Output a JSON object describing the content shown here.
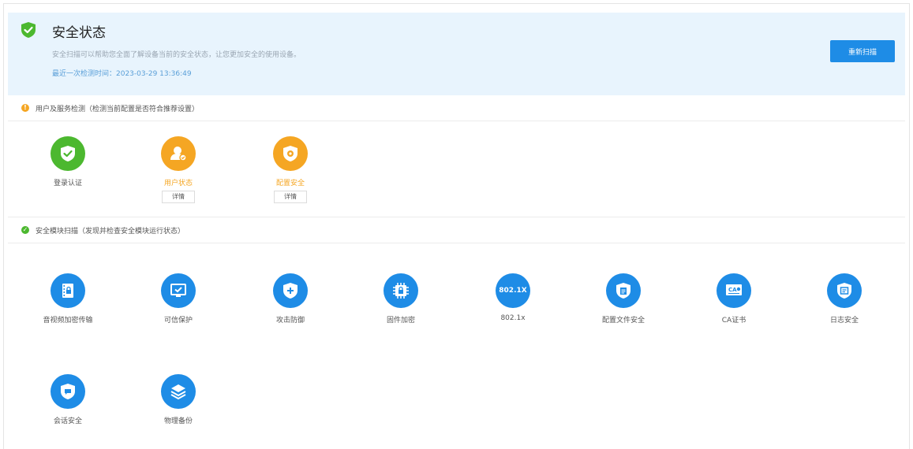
{
  "banner": {
    "title": "安全状态",
    "description": "安全扫描可以帮助您全面了解设备当前的安全状态，让您更加安全的使用设备。",
    "last_check": "最近一次检测时间：2023-03-29 13:36:49",
    "rescan_label": "重新扫描"
  },
  "section1": {
    "label": "用户及服务检测（检测当前配置是否符合推荐设置）",
    "items": [
      {
        "label": "登录认证",
        "icon": "shield-check-icon",
        "status": "ok"
      },
      {
        "label": "用户状态",
        "icon": "user-icon",
        "status": "warning",
        "detail": "详情"
      },
      {
        "label": "配置安全",
        "icon": "shield-gear-icon",
        "status": "warning",
        "detail": "详情"
      }
    ]
  },
  "section2": {
    "label": "安全模块扫描（发现并检查安全模块运行状态）",
    "items": [
      {
        "label": "音视频加密传输",
        "icon": "film-lock-icon"
      },
      {
        "label": "可信保护",
        "icon": "monitor-check-icon"
      },
      {
        "label": "攻击防御",
        "icon": "shield-plus-icon"
      },
      {
        "label": "固件加密",
        "icon": "chip-lock-icon"
      },
      {
        "label": "802.1x",
        "icon": "802-1x-icon",
        "icon_text": "802.1X"
      },
      {
        "label": "配置文件安全",
        "icon": "file-shield-icon"
      },
      {
        "label": "CA证书",
        "icon": "ca-certificate-icon",
        "icon_text": "CA"
      },
      {
        "label": "日志安全",
        "icon": "log-shield-icon"
      },
      {
        "label": "会话安全",
        "icon": "chat-shield-icon"
      },
      {
        "label": "物理备份",
        "icon": "layers-icon"
      }
    ]
  },
  "colors": {
    "ok": "#4cb82f",
    "warning": "#f5a623",
    "module": "#1e8ce6",
    "banner_bg": "#e8f4fd"
  }
}
